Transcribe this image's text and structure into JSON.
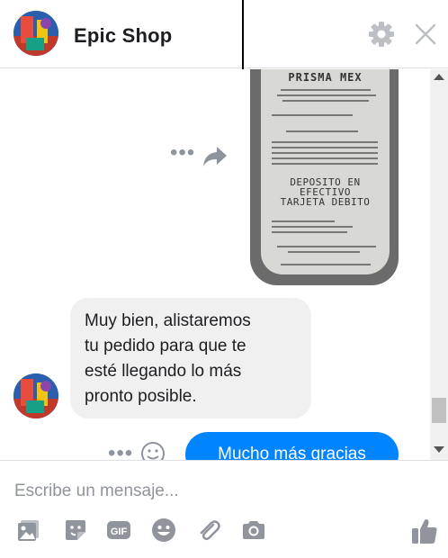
{
  "header": {
    "shop_name": "Epic Shop"
  },
  "receipt": {
    "title": "PRISMA MEX",
    "deposit_text": "DEPOSITO EN\nEFECTIVO\nTARJETA DEBITO"
  },
  "messages": {
    "incoming": "Muy bien, alistaremos\ntu pedido para que te\nesté llegando lo más\npronto posible.",
    "outgoing": "Mucho más gracias"
  },
  "composer": {
    "placeholder": "Escribe un mensaje..."
  },
  "icons": {
    "gear": "gear-icon",
    "close": "close-icon",
    "share": "share-icon",
    "more": "more-options-icon",
    "emoji": "smiley-icon",
    "photo": "photo-icon",
    "sticker": "sticker-icon",
    "gif": "gif-icon",
    "attach": "paperclip-icon",
    "camera": "camera-icon",
    "like": "thumbs-up-icon"
  },
  "colors": {
    "accent": "#0084ff",
    "icon_gray": "#90949c",
    "bubble_gray": "#f1f0f0"
  }
}
